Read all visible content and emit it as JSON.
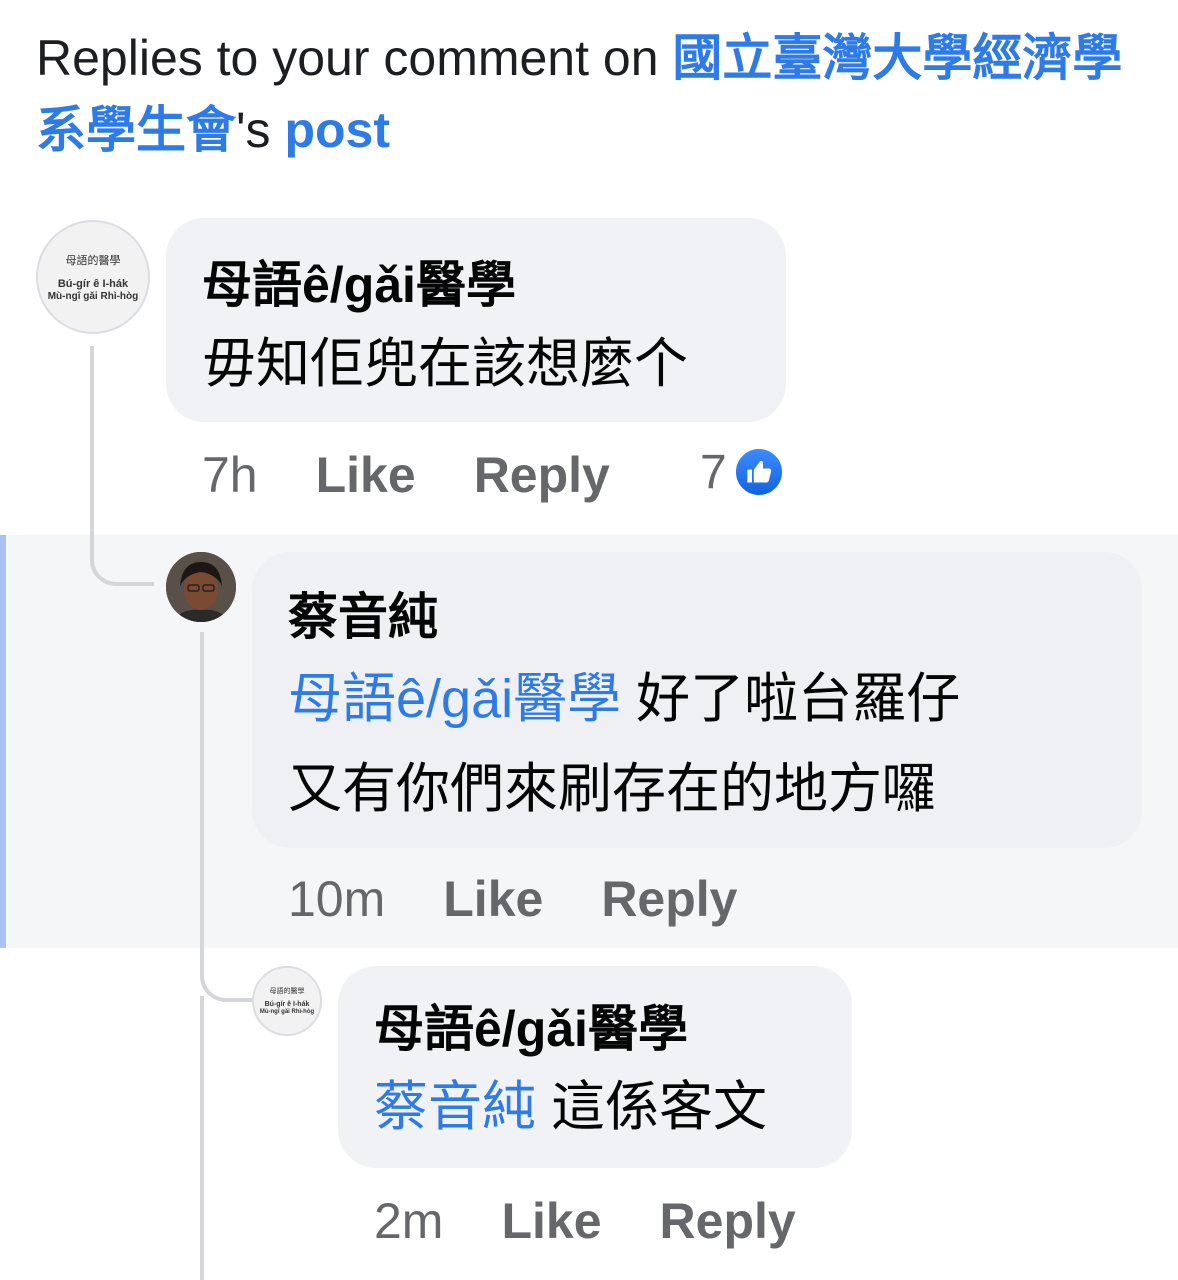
{
  "header": {
    "prefix": "Replies to your comment on ",
    "page_name": "國立臺灣大學經濟學系學生會",
    "possessive": "'s ",
    "post_link": "post"
  },
  "comments": [
    {
      "author": "母語ê/gǎi醫學",
      "text": "毋知佢兜在該想麼个",
      "time": "7h",
      "like_label": "Like",
      "reply_label": "Reply",
      "reaction_count": "7",
      "avatar": {
        "line1": "母語的醫學",
        "line2": "Bú-gír ê I-hák",
        "line3": "Mù-ngî gǎi Rhì-hòg"
      }
    },
    {
      "author": "蔡音純",
      "mention": "母語ê/gǎi醫學",
      "text_line1": " 好了啦台羅仔",
      "text_line2": "又有你們來刷存在的地方囉",
      "time": "10m",
      "like_label": "Like",
      "reply_label": "Reply"
    },
    {
      "author": "母語ê/gǎi醫學",
      "mention": "蔡音純",
      "text": " 這係客文",
      "time": "2m",
      "like_label": "Like",
      "reply_label": "Reply",
      "avatar": {
        "line1": "母語的醫學",
        "line2": "Bú-gír ê I-hák",
        "line3": "Mù-ngî gǎi Rhì-hòg"
      }
    }
  ],
  "icons": {
    "reaction": "like-thumb-icon"
  },
  "colors": {
    "link": "#2f7be6",
    "bubble": "#f0f2f5",
    "highlight": "#f5f6f8",
    "like_badge": "#1877f2"
  }
}
